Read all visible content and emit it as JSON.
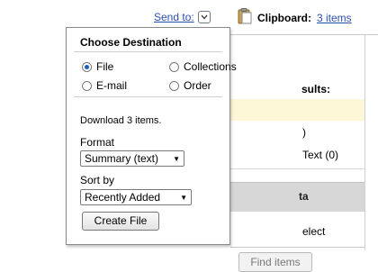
{
  "header": {
    "send_to_label": "Send to:",
    "clipboard_label": "Clipboard:",
    "clipboard_count": "3 items"
  },
  "background": {
    "results_label": "sults:",
    "zero_count": ")",
    "text_count": "Text (0)",
    "column_header": "ta",
    "select_label": "elect",
    "find_items_button": "Find items"
  },
  "popup": {
    "title": "Choose Destination",
    "destinations": [
      {
        "label": "File",
        "selected": true
      },
      {
        "label": "Collections",
        "selected": false
      },
      {
        "label": "E-mail",
        "selected": false
      },
      {
        "label": "Order",
        "selected": false
      }
    ],
    "download_text": "Download 3 items.",
    "format_label": "Format",
    "format_value": "Summary (text)",
    "sort_label": "Sort by",
    "sort_value": "Recently Added",
    "create_button": "Create File"
  },
  "colors": {
    "link": "#2a4fb0",
    "highlight_row": "#fdf6d7",
    "header_gray": "#d7d7d7",
    "radio_selected": "#1c5fbf"
  }
}
